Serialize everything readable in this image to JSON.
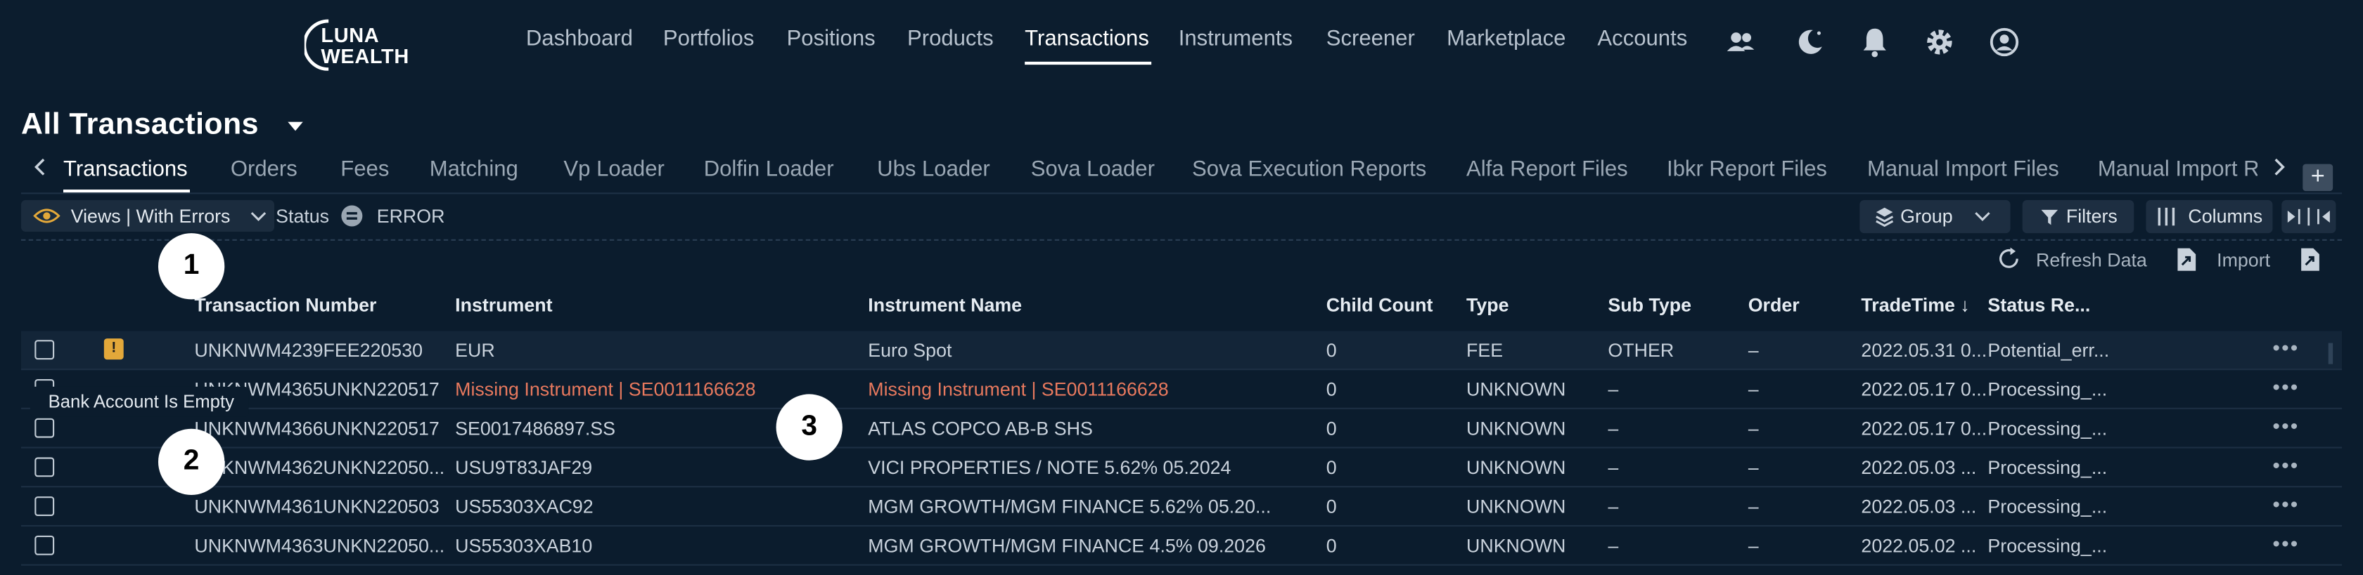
{
  "brand": {
    "line1": "LUNA",
    "line2": "WEALTH"
  },
  "nav": {
    "items": [
      "Dashboard",
      "Portfolios",
      "Positions",
      "Products",
      "Transactions",
      "Instruments",
      "Screener",
      "Marketplace",
      "Accounts"
    ],
    "active": "Transactions",
    "icons": [
      "users-icon",
      "moon-icon",
      "bell-icon",
      "gear-icon",
      "user-circle-icon"
    ]
  },
  "page": {
    "title": "All Transactions"
  },
  "tabs": {
    "items": [
      "Transactions",
      "Orders",
      "Fees",
      "Matching",
      "Vp Loader",
      "Dolfin Loader",
      "Ubs Loader",
      "Sova Loader",
      "Sova Execution Reports",
      "Alfa Report Files",
      "Ibkr Report Files",
      "Manual Import Files",
      "Manual Import R"
    ],
    "active": "Transactions",
    "add_label": "+"
  },
  "filters": {
    "views_label": "Views | With Errors",
    "status_label": "Status",
    "status_value": "ERROR",
    "group_label": "Group",
    "filters_label": "Filters",
    "columns_label": "Columns"
  },
  "toolbar": {
    "refresh_label": "Refresh Data",
    "import_label": "Import"
  },
  "badges": [
    "1",
    "2",
    "3"
  ],
  "tooltip": "Bank Account Is Empty",
  "table": {
    "columns": [
      "Transaction Number",
      "Instrument",
      "Instrument Name",
      "Child Count",
      "Type",
      "Sub Type",
      "Order",
      "TradeTime ↓",
      "Status Re..."
    ],
    "rows": [
      {
        "number": "UNKNWM4239FEE220530",
        "instrument": "EUR",
        "name": "Euro Spot",
        "child": "0",
        "type": "FEE",
        "subtype": "OTHER",
        "order": "–",
        "time": "2022.05.31 0...",
        "status": "Potential_err...",
        "warning": true,
        "error": false
      },
      {
        "number": "UNKNWM4365UNKN220517",
        "instrument": "Missing Instrument | SE0011166628",
        "name": "Missing Instrument | SE0011166628",
        "child": "0",
        "type": "UNKNOWN",
        "subtype": "–",
        "order": "–",
        "time": "2022.05.17 0...",
        "status": "Processing_...",
        "warning": false,
        "error": true
      },
      {
        "number": "UNKNWM4366UNKN220517",
        "instrument": "SE0017486897.SS",
        "name": "ATLAS COPCO AB-B SHS",
        "child": "0",
        "type": "UNKNOWN",
        "subtype": "–",
        "order": "–",
        "time": "2022.05.17 0...",
        "status": "Processing_...",
        "warning": false,
        "error": false
      },
      {
        "number": "UNKNWM4362UNKN22050...",
        "instrument": "USU9T83JAF29",
        "name": "VICI PROPERTIES / NOTE 5.62% 05.2024",
        "child": "0",
        "type": "UNKNOWN",
        "subtype": "–",
        "order": "–",
        "time": "2022.05.03 ...",
        "status": "Processing_...",
        "warning": false,
        "error": false
      },
      {
        "number": "UNKNWM4361UNKN220503",
        "instrument": "US55303XAC92",
        "name": "MGM GROWTH/MGM FINANCE 5.62% 05.20...",
        "child": "0",
        "type": "UNKNOWN",
        "subtype": "–",
        "order": "–",
        "time": "2022.05.03 ...",
        "status": "Processing_...",
        "warning": false,
        "error": false
      },
      {
        "number": "UNKNWM4363UNKN22050...",
        "instrument": "US55303XAB10",
        "name": "MGM GROWTH/MGM FINANCE 4.5% 09.2026",
        "child": "0",
        "type": "UNKNOWN",
        "subtype": "–",
        "order": "–",
        "time": "2022.05.02 ...",
        "status": "Processing_...",
        "warning": false,
        "error": false
      }
    ]
  },
  "colors": {
    "background": "#0b1c2d",
    "error_text": "#e8795e",
    "warning_badge": "#e3a83a",
    "accent": "#ffffff"
  }
}
